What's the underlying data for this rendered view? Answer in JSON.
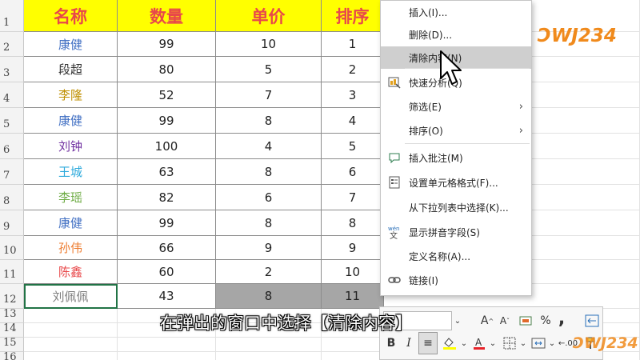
{
  "sheet": {
    "headers": [
      "名称",
      "数量",
      "单价",
      "排序"
    ],
    "rows": [
      {
        "num": "2",
        "name": "康健",
        "name_color": "#4472c4",
        "qty": "99",
        "price": "10",
        "order": "1"
      },
      {
        "num": "3",
        "name": "段超",
        "name_color": "#333333",
        "qty": "80",
        "price": "5",
        "order": "2"
      },
      {
        "num": "4",
        "name": "李隆",
        "name_color": "#bf8f00",
        "qty": "52",
        "price": "7",
        "order": "3"
      },
      {
        "num": "5",
        "name": "康健",
        "name_color": "#4472c4",
        "qty": "99",
        "price": "8",
        "order": "4"
      },
      {
        "num": "6",
        "name": "刘钟",
        "name_color": "#7030a0",
        "qty": "100",
        "price": "4",
        "order": "5"
      },
      {
        "num": "7",
        "name": "王城",
        "name_color": "#2eaadc",
        "qty": "63",
        "price": "8",
        "order": "6"
      },
      {
        "num": "8",
        "name": "李瑶",
        "name_color": "#70ad47",
        "qty": "82",
        "price": "6",
        "order": "7"
      },
      {
        "num": "9",
        "name": "康健",
        "name_color": "#4472c4",
        "qty": "99",
        "price": "8",
        "order": "8"
      },
      {
        "num": "10",
        "name": "孙伟",
        "name_color": "#ed7d31",
        "qty": "66",
        "price": "9",
        "order": "9"
      },
      {
        "num": "11",
        "name": "陈鑫",
        "name_color": "#e8484a",
        "qty": "60",
        "price": "2",
        "order": "10"
      },
      {
        "num": "12",
        "name": "刘佩佩",
        "name_color": "#7f7f7f",
        "qty": "43",
        "price": "8",
        "order": "11"
      }
    ],
    "header_row_num": "1",
    "empty_rows": [
      "13",
      "14",
      "15",
      "16"
    ],
    "header_fill": "#ffff00",
    "header_text_color": "#e8484a",
    "selection_fill": "#a6a6a6"
  },
  "context_menu": {
    "items": [
      {
        "label": "插入(I)...",
        "icon": ""
      },
      {
        "label": "删除(D)...",
        "icon": ""
      },
      {
        "label": "清除内容(N)",
        "icon": "",
        "hover": true
      },
      {
        "label": "快速分析(Q)",
        "icon": "quick-analysis-icon"
      },
      {
        "label": "筛选(E)",
        "icon": "",
        "submenu": true
      },
      {
        "label": "排序(O)",
        "icon": "",
        "submenu": true
      },
      {
        "label": "插入批注(M)",
        "icon": "insert-comment-icon"
      },
      {
        "label": "设置单元格格式(F)...",
        "icon": "format-cells-icon"
      },
      {
        "label": "从下拉列表中选择(K)...",
        "icon": ""
      },
      {
        "label": "显示拼音字段(S)",
        "icon": "phonetic-icon"
      },
      {
        "label": "定义名称(A)...",
        "icon": ""
      },
      {
        "label": "链接(I)",
        "icon": "link-icon"
      }
    ],
    "phonetic_icon_text": "wén\n文",
    "submenu_arrow": "›"
  },
  "mini_toolbar": {
    "bold": "B",
    "italic": "I",
    "font_grow": "A",
    "font_shrink": "A",
    "percent": "%",
    "comma": ","
  },
  "subtitle": "在弹出的窗口中选择【清除内容】",
  "watermark": "ƆWJ234",
  "colors": {
    "accent_green": "#217346",
    "logo_orange": "#f08a1c"
  }
}
